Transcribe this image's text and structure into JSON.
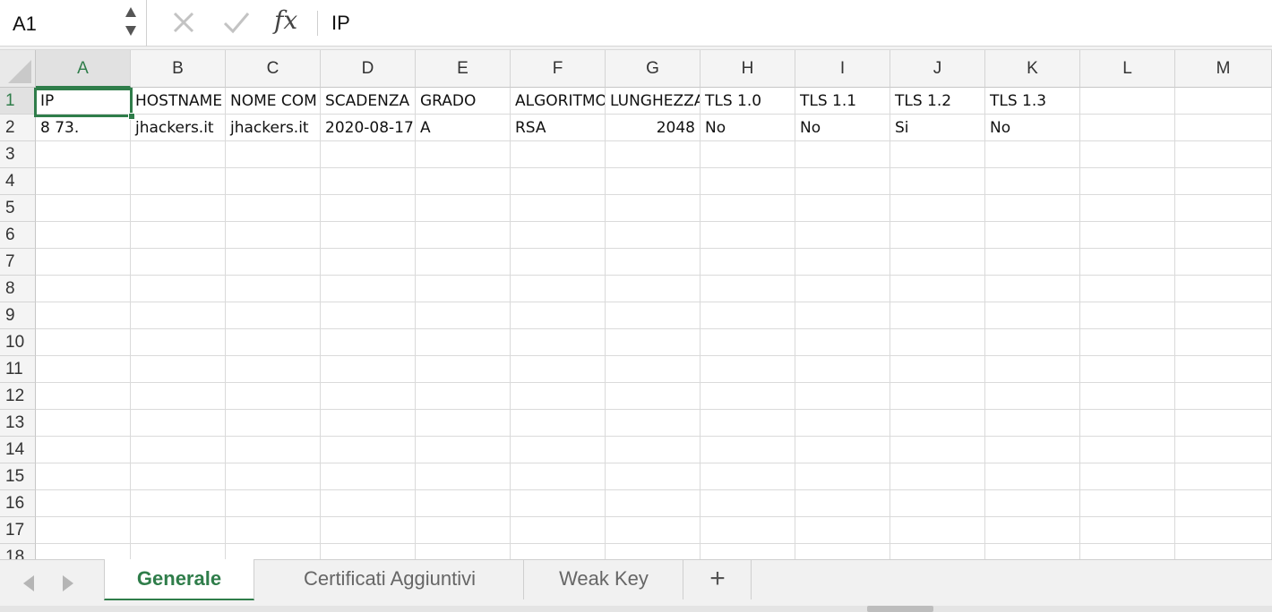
{
  "name_box": {
    "value": "A1"
  },
  "formula_bar": {
    "content": "IP",
    "fx_label": "fx"
  },
  "columns": [
    "A",
    "B",
    "C",
    "D",
    "E",
    "F",
    "G",
    "H",
    "I",
    "J",
    "K",
    "L",
    "M"
  ],
  "rows": [
    "1",
    "2",
    "3",
    "4",
    "5",
    "6",
    "7",
    "8",
    "9",
    "10",
    "11",
    "12",
    "13",
    "14",
    "15",
    "16",
    "17",
    "18"
  ],
  "cells": {
    "A1": "IP",
    "B1": "HOSTNAME",
    "C1": "NOME COM",
    "D1": "SCADENZA C",
    "E1": "GRADO",
    "F1": "ALGORITMO",
    "G1": "LUNGHEZZA",
    "H1": "TLS 1.0",
    "I1": "TLS 1.1",
    "J1": "TLS 1.2",
    "K1": "TLS 1.3",
    "A2": "8           73.",
    "B2": "jhackers.it",
    "C2": "jhackers.it",
    "D2": "2020-08-17",
    "E2": "A",
    "F2": "RSA",
    "G2": "2048",
    "H2": "No",
    "I2": "No",
    "J2": "Si",
    "K2": "No"
  },
  "selected_cell": "A1",
  "sheets": [
    {
      "label": "Generale",
      "active": true
    },
    {
      "label": "Certificati Aggiuntivi",
      "active": false
    },
    {
      "label": "Weak Key",
      "active": false
    }
  ],
  "add_sheet_label": "+",
  "colors": {
    "accent": "#2f7d4a",
    "header_bg": "#f4f4f4",
    "grid_line": "#dadada"
  }
}
